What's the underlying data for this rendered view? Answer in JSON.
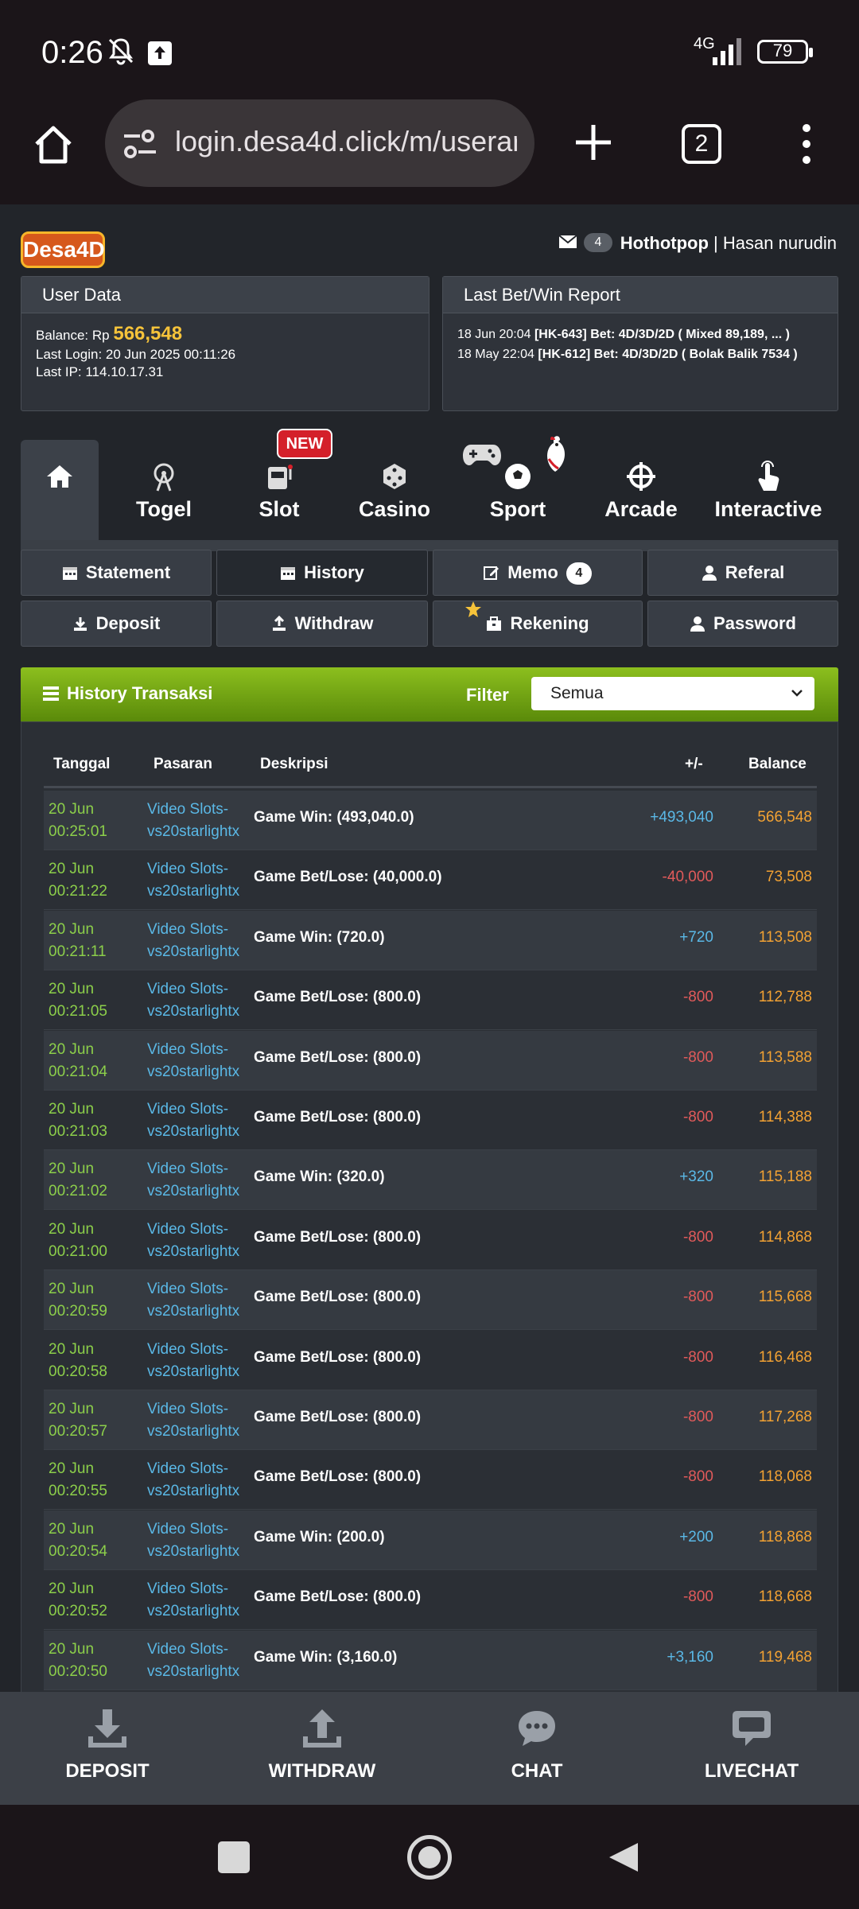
{
  "status_bar": {
    "time": "0:26",
    "network": "4G",
    "battery": "79"
  },
  "browser": {
    "url": "login.desa4d.click/m/userar",
    "tab_count": "2"
  },
  "header": {
    "logo": "Desa4D",
    "mail_count": "4",
    "username": "Hothotpop",
    "separator": " | ",
    "fullname": "Hasan nurudin"
  },
  "user_data": {
    "title": "User Data",
    "balance_label": "Balance: Rp ",
    "balance": "566,548",
    "last_login": "Last Login: 20 Jun 2025 00:11:26",
    "last_ip": "Last IP: 114.10.17.31"
  },
  "last_bet": {
    "title": "Last Bet/Win Report",
    "lines": [
      {
        "date": "18 Jun 20:04 ",
        "detail": "[HK-643] Bet: 4D/3D/2D ( Mixed 89,189, ... )"
      },
      {
        "date": "18 May 22:04 ",
        "detail": "[HK-612] Bet: 4D/3D/2D ( Bolak Balik 7534 )"
      }
    ]
  },
  "categories": {
    "new_badge": "NEW",
    "items": [
      "Togel",
      "Slot",
      "Casino",
      "Sport",
      "Arcade",
      "Interactive"
    ]
  },
  "account_tabs": {
    "statement": "Statement",
    "history": "History",
    "memo": "Memo",
    "memo_count": "4",
    "referal": "Referal",
    "deposit": "Deposit",
    "withdraw": "Withdraw",
    "rekening": "Rekening",
    "password": "Password"
  },
  "history": {
    "title": "History Transaksi",
    "filter_label": "Filter",
    "filter_value": "Semua",
    "columns": {
      "date": "Tanggal",
      "market": "Pasaran",
      "desc": "Deskripsi",
      "amount": "+/-",
      "balance": "Balance"
    },
    "rows": [
      {
        "d1": "20 Jun",
        "d2": "00:25:01",
        "m1": "Video Slots-",
        "m2": "vs20starlightx",
        "desc": "Game Win: (493,040.0)",
        "amount": "+493,040",
        "sign": "pos",
        "balance": "566,548"
      },
      {
        "d1": "20 Jun",
        "d2": "00:21:22",
        "m1": "Video Slots-",
        "m2": "vs20starlightx",
        "desc": "Game Bet/Lose: (40,000.0)",
        "amount": "-40,000",
        "sign": "neg",
        "balance": "73,508"
      },
      {
        "d1": "20 Jun",
        "d2": "00:21:11",
        "m1": "Video Slots-",
        "m2": "vs20starlightx",
        "desc": "Game Win: (720.0)",
        "amount": "+720",
        "sign": "pos",
        "balance": "113,508"
      },
      {
        "d1": "20 Jun",
        "d2": "00:21:05",
        "m1": "Video Slots-",
        "m2": "vs20starlightx",
        "desc": "Game Bet/Lose: (800.0)",
        "amount": "-800",
        "sign": "neg",
        "balance": "112,788"
      },
      {
        "d1": "20 Jun",
        "d2": "00:21:04",
        "m1": "Video Slots-",
        "m2": "vs20starlightx",
        "desc": "Game Bet/Lose: (800.0)",
        "amount": "-800",
        "sign": "neg",
        "balance": "113,588"
      },
      {
        "d1": "20 Jun",
        "d2": "00:21:03",
        "m1": "Video Slots-",
        "m2": "vs20starlightx",
        "desc": "Game Bet/Lose: (800.0)",
        "amount": "-800",
        "sign": "neg",
        "balance": "114,388"
      },
      {
        "d1": "20 Jun",
        "d2": "00:21:02",
        "m1": "Video Slots-",
        "m2": "vs20starlightx",
        "desc": "Game Win: (320.0)",
        "amount": "+320",
        "sign": "pos",
        "balance": "115,188"
      },
      {
        "d1": "20 Jun",
        "d2": "00:21:00",
        "m1": "Video Slots-",
        "m2": "vs20starlightx",
        "desc": "Game Bet/Lose: (800.0)",
        "amount": "-800",
        "sign": "neg",
        "balance": "114,868"
      },
      {
        "d1": "20 Jun",
        "d2": "00:20:59",
        "m1": "Video Slots-",
        "m2": "vs20starlightx",
        "desc": "Game Bet/Lose: (800.0)",
        "amount": "-800",
        "sign": "neg",
        "balance": "115,668"
      },
      {
        "d1": "20 Jun",
        "d2": "00:20:58",
        "m1": "Video Slots-",
        "m2": "vs20starlightx",
        "desc": "Game Bet/Lose: (800.0)",
        "amount": "-800",
        "sign": "neg",
        "balance": "116,468"
      },
      {
        "d1": "20 Jun",
        "d2": "00:20:57",
        "m1": "Video Slots-",
        "m2": "vs20starlightx",
        "desc": "Game Bet/Lose: (800.0)",
        "amount": "-800",
        "sign": "neg",
        "balance": "117,268"
      },
      {
        "d1": "20 Jun",
        "d2": "00:20:55",
        "m1": "Video Slots-",
        "m2": "vs20starlightx",
        "desc": "Game Bet/Lose: (800.0)",
        "amount": "-800",
        "sign": "neg",
        "balance": "118,068"
      },
      {
        "d1": "20 Jun",
        "d2": "00:20:54",
        "m1": "Video Slots-",
        "m2": "vs20starlightx",
        "desc": "Game Win: (200.0)",
        "amount": "+200",
        "sign": "pos",
        "balance": "118,868"
      },
      {
        "d1": "20 Jun",
        "d2": "00:20:52",
        "m1": "Video Slots-",
        "m2": "vs20starlightx",
        "desc": "Game Bet/Lose: (800.0)",
        "amount": "-800",
        "sign": "neg",
        "balance": "118,668"
      },
      {
        "d1": "20 Jun",
        "d2": "00:20:50",
        "m1": "Video Slots-",
        "m2": "vs20starlightx",
        "desc": "Game Win: (3,160.0)",
        "amount": "+3,160",
        "sign": "pos",
        "balance": "119,468"
      }
    ]
  },
  "bottom_bar": {
    "deposit": "DEPOSIT",
    "withdraw": "WITHDRAW",
    "chat": "CHAT",
    "livechat": "LIVECHAT"
  },
  "colors": {
    "accent_green": "#8cbf1e",
    "balance_yellow": "#f6c33a",
    "positive": "#5ab8e6",
    "negative": "#e05a5a"
  }
}
